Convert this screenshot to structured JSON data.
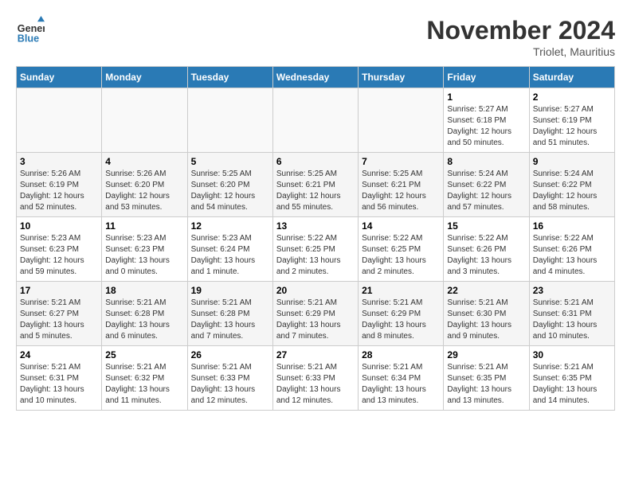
{
  "header": {
    "logo_line1": "General",
    "logo_line2": "Blue",
    "month": "November 2024",
    "location": "Triolet, Mauritius"
  },
  "weekdays": [
    "Sunday",
    "Monday",
    "Tuesday",
    "Wednesday",
    "Thursday",
    "Friday",
    "Saturday"
  ],
  "weeks": [
    [
      {
        "day": "",
        "info": ""
      },
      {
        "day": "",
        "info": ""
      },
      {
        "day": "",
        "info": ""
      },
      {
        "day": "",
        "info": ""
      },
      {
        "day": "",
        "info": ""
      },
      {
        "day": "1",
        "info": "Sunrise: 5:27 AM\nSunset: 6:18 PM\nDaylight: 12 hours\nand 50 minutes."
      },
      {
        "day": "2",
        "info": "Sunrise: 5:27 AM\nSunset: 6:19 PM\nDaylight: 12 hours\nand 51 minutes."
      }
    ],
    [
      {
        "day": "3",
        "info": "Sunrise: 5:26 AM\nSunset: 6:19 PM\nDaylight: 12 hours\nand 52 minutes."
      },
      {
        "day": "4",
        "info": "Sunrise: 5:26 AM\nSunset: 6:20 PM\nDaylight: 12 hours\nand 53 minutes."
      },
      {
        "day": "5",
        "info": "Sunrise: 5:25 AM\nSunset: 6:20 PM\nDaylight: 12 hours\nand 54 minutes."
      },
      {
        "day": "6",
        "info": "Sunrise: 5:25 AM\nSunset: 6:21 PM\nDaylight: 12 hours\nand 55 minutes."
      },
      {
        "day": "7",
        "info": "Sunrise: 5:25 AM\nSunset: 6:21 PM\nDaylight: 12 hours\nand 56 minutes."
      },
      {
        "day": "8",
        "info": "Sunrise: 5:24 AM\nSunset: 6:22 PM\nDaylight: 12 hours\nand 57 minutes."
      },
      {
        "day": "9",
        "info": "Sunrise: 5:24 AM\nSunset: 6:22 PM\nDaylight: 12 hours\nand 58 minutes."
      }
    ],
    [
      {
        "day": "10",
        "info": "Sunrise: 5:23 AM\nSunset: 6:23 PM\nDaylight: 12 hours\nand 59 minutes."
      },
      {
        "day": "11",
        "info": "Sunrise: 5:23 AM\nSunset: 6:23 PM\nDaylight: 13 hours\nand 0 minutes."
      },
      {
        "day": "12",
        "info": "Sunrise: 5:23 AM\nSunset: 6:24 PM\nDaylight: 13 hours\nand 1 minute."
      },
      {
        "day": "13",
        "info": "Sunrise: 5:22 AM\nSunset: 6:25 PM\nDaylight: 13 hours\nand 2 minutes."
      },
      {
        "day": "14",
        "info": "Sunrise: 5:22 AM\nSunset: 6:25 PM\nDaylight: 13 hours\nand 2 minutes."
      },
      {
        "day": "15",
        "info": "Sunrise: 5:22 AM\nSunset: 6:26 PM\nDaylight: 13 hours\nand 3 minutes."
      },
      {
        "day": "16",
        "info": "Sunrise: 5:22 AM\nSunset: 6:26 PM\nDaylight: 13 hours\nand 4 minutes."
      }
    ],
    [
      {
        "day": "17",
        "info": "Sunrise: 5:21 AM\nSunset: 6:27 PM\nDaylight: 13 hours\nand 5 minutes."
      },
      {
        "day": "18",
        "info": "Sunrise: 5:21 AM\nSunset: 6:28 PM\nDaylight: 13 hours\nand 6 minutes."
      },
      {
        "day": "19",
        "info": "Sunrise: 5:21 AM\nSunset: 6:28 PM\nDaylight: 13 hours\nand 7 minutes."
      },
      {
        "day": "20",
        "info": "Sunrise: 5:21 AM\nSunset: 6:29 PM\nDaylight: 13 hours\nand 7 minutes."
      },
      {
        "day": "21",
        "info": "Sunrise: 5:21 AM\nSunset: 6:29 PM\nDaylight: 13 hours\nand 8 minutes."
      },
      {
        "day": "22",
        "info": "Sunrise: 5:21 AM\nSunset: 6:30 PM\nDaylight: 13 hours\nand 9 minutes."
      },
      {
        "day": "23",
        "info": "Sunrise: 5:21 AM\nSunset: 6:31 PM\nDaylight: 13 hours\nand 10 minutes."
      }
    ],
    [
      {
        "day": "24",
        "info": "Sunrise: 5:21 AM\nSunset: 6:31 PM\nDaylight: 13 hours\nand 10 minutes."
      },
      {
        "day": "25",
        "info": "Sunrise: 5:21 AM\nSunset: 6:32 PM\nDaylight: 13 hours\nand 11 minutes."
      },
      {
        "day": "26",
        "info": "Sunrise: 5:21 AM\nSunset: 6:33 PM\nDaylight: 13 hours\nand 12 minutes."
      },
      {
        "day": "27",
        "info": "Sunrise: 5:21 AM\nSunset: 6:33 PM\nDaylight: 13 hours\nand 12 minutes."
      },
      {
        "day": "28",
        "info": "Sunrise: 5:21 AM\nSunset: 6:34 PM\nDaylight: 13 hours\nand 13 minutes."
      },
      {
        "day": "29",
        "info": "Sunrise: 5:21 AM\nSunset: 6:35 PM\nDaylight: 13 hours\nand 13 minutes."
      },
      {
        "day": "30",
        "info": "Sunrise: 5:21 AM\nSunset: 6:35 PM\nDaylight: 13 hours\nand 14 minutes."
      }
    ]
  ]
}
